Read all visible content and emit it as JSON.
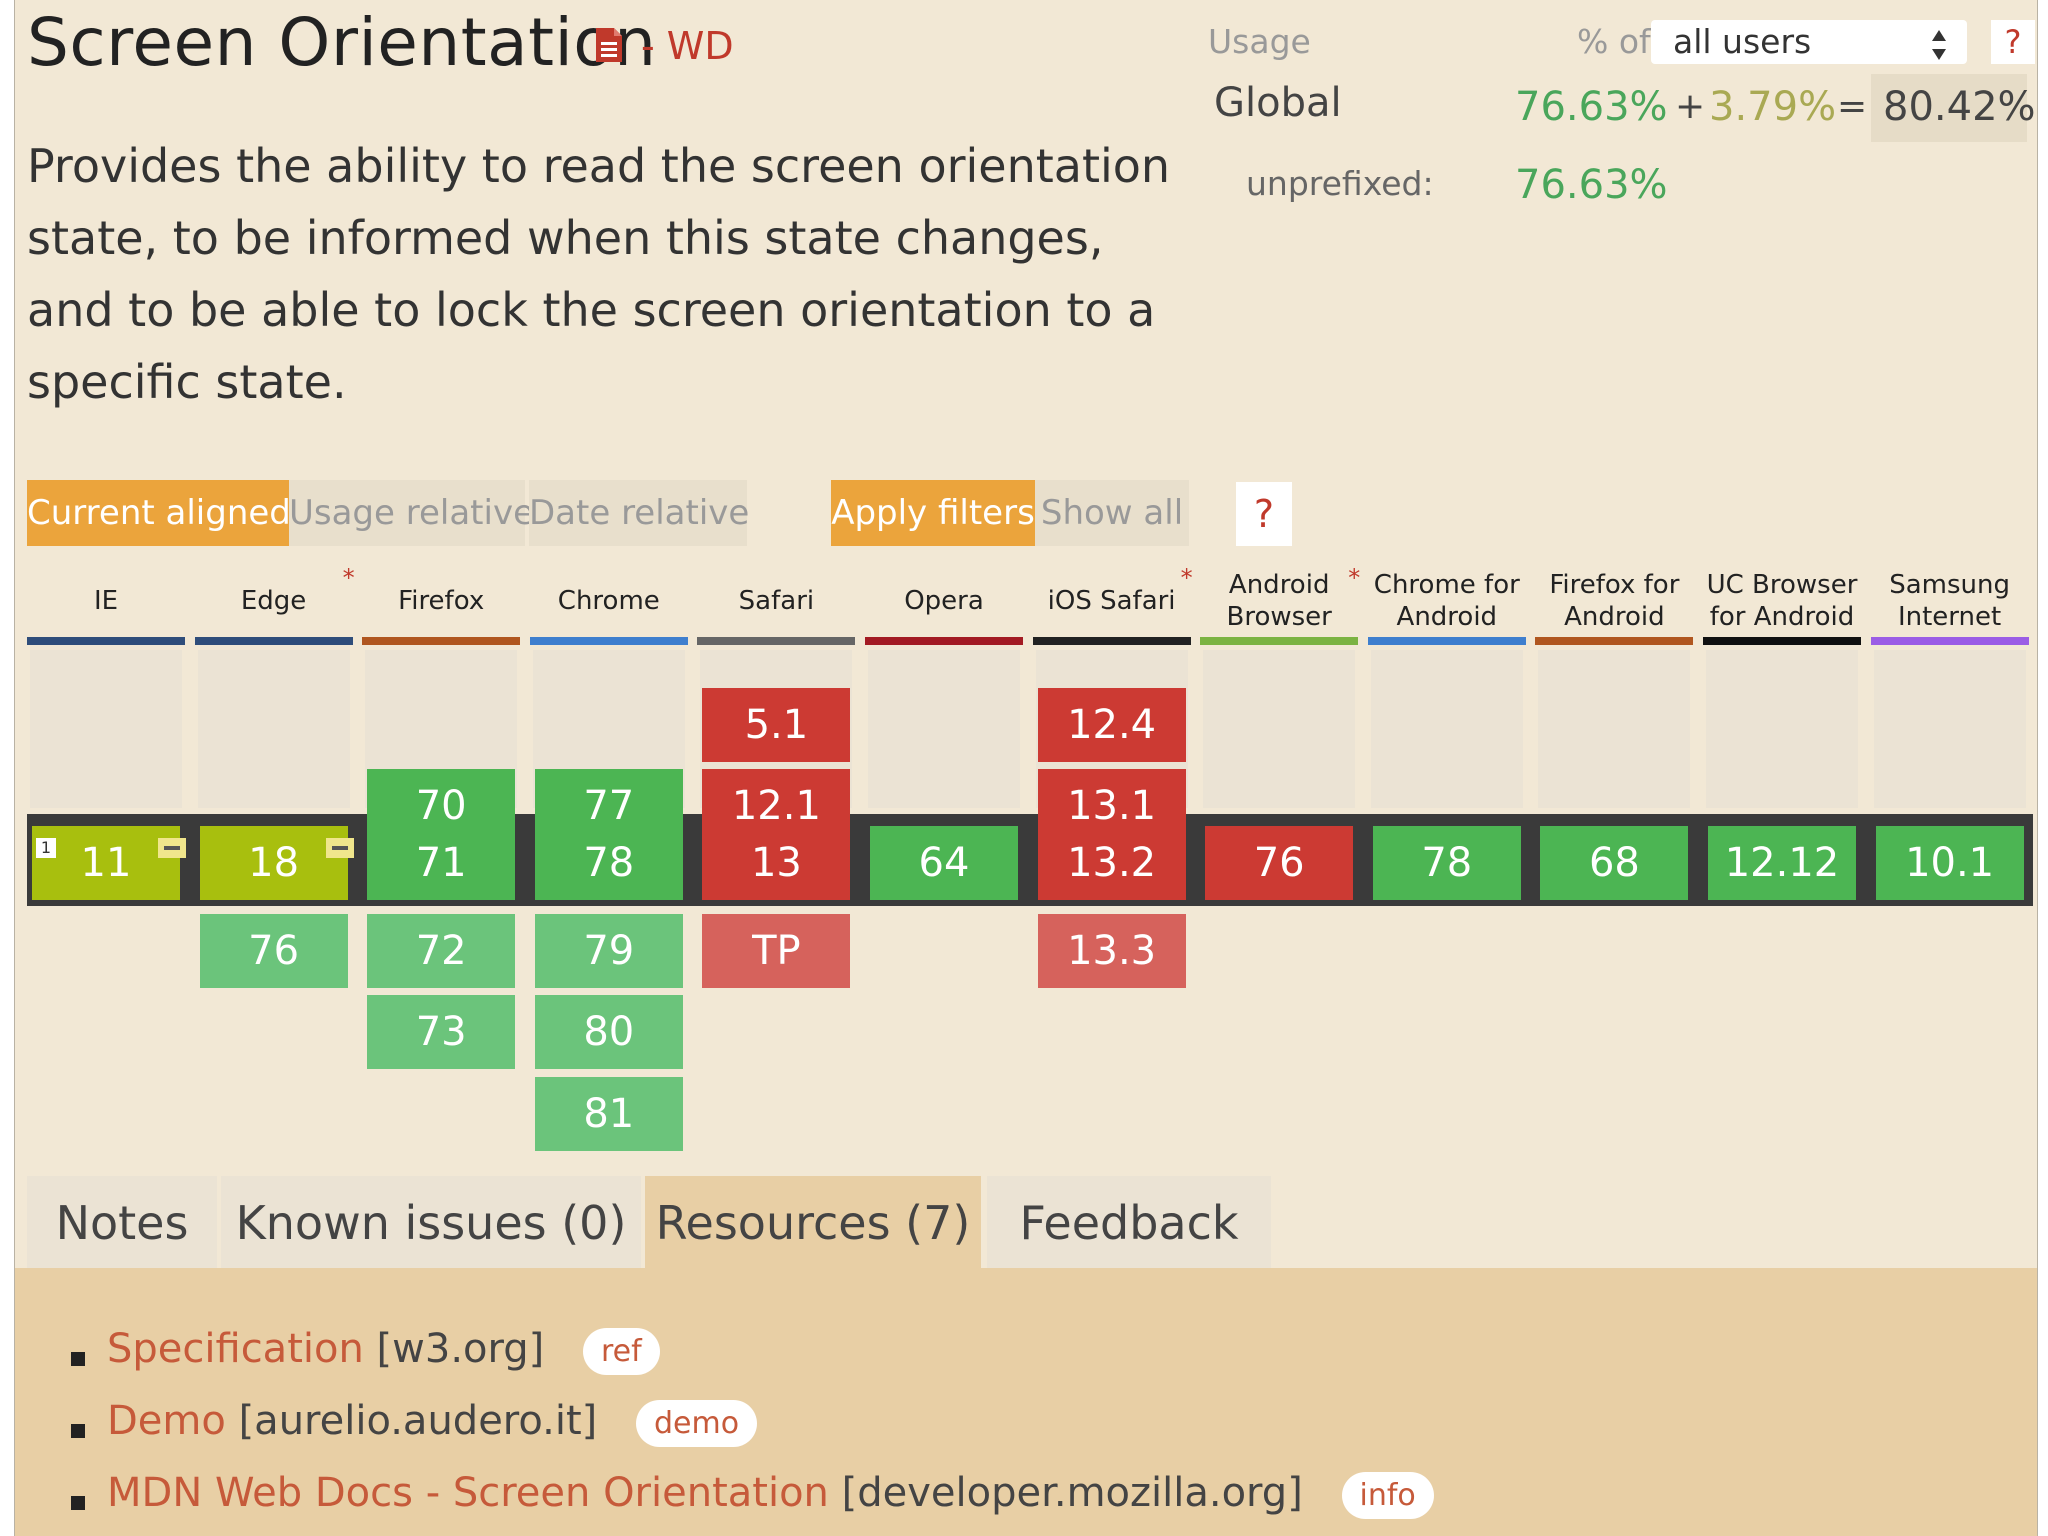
{
  "feature": {
    "title": "Screen Orientation",
    "doc_icon": "document-icon",
    "status": "- WD",
    "description": "Provides the ability to read the screen orientation state, to be informed when this state changes, and to be able to lock the screen orientation to a specific state."
  },
  "usage": {
    "label": "Usage",
    "pct_of": "% of",
    "user_select": "all users",
    "help": "?",
    "global_label": "Global",
    "global_supported": "76.63%",
    "plus": "+",
    "global_partial": "3.79%",
    "equals": "=",
    "global_total": "80.42%",
    "unprefixed_label": "unprefixed:",
    "unprefixed_value": "76.63%"
  },
  "controls": {
    "current_aligned": "Current aligned",
    "usage_relative": "Usage relative",
    "date_relative": "Date relative",
    "apply_filters": "Apply filters",
    "show_all": "Show all",
    "help": "?"
  },
  "colors": {
    "supported": "#4cb553",
    "supported_future": "#6bc47b",
    "unsupported": "#cc3a33",
    "unsupported_future": "#d6625c",
    "partial": "#a8bf0e",
    "accent": "#eba43c"
  },
  "browsers": [
    {
      "name": "IE",
      "star": false,
      "bar": "#2f4d7a",
      "past": [],
      "current": "11",
      "current_support": "partial",
      "note": "1",
      "future": []
    },
    {
      "name": "Edge",
      "star": true,
      "bar": "#2f4d7a",
      "past": [],
      "current": "18",
      "current_support": "partial",
      "future": [
        {
          "v": "76",
          "s": "y"
        }
      ]
    },
    {
      "name": "Firefox",
      "star": false,
      "bar": "#b0561f",
      "past": [
        {
          "v": "70",
          "s": "y"
        }
      ],
      "current": "71",
      "current_support": "supported",
      "future": [
        {
          "v": "72",
          "s": "y"
        },
        {
          "v": "73",
          "s": "y"
        }
      ]
    },
    {
      "name": "Chrome",
      "star": false,
      "bar": "#3f7fce",
      "past": [
        {
          "v": "77",
          "s": "y"
        }
      ],
      "current": "78",
      "current_support": "supported",
      "future": [
        {
          "v": "79",
          "s": "y"
        },
        {
          "v": "80",
          "s": "y"
        },
        {
          "v": "81",
          "s": "y"
        }
      ]
    },
    {
      "name": "Safari",
      "star": false,
      "bar": "#666666",
      "past": [
        {
          "v": "5.1",
          "s": "n"
        },
        {
          "v": "12.1",
          "s": "n"
        }
      ],
      "current": "13",
      "current_support": "unsupported",
      "future": [
        {
          "v": "TP",
          "s": "n"
        }
      ]
    },
    {
      "name": "Opera",
      "star": false,
      "bar": "#a31b23",
      "past": [],
      "current": "64",
      "current_support": "supported",
      "future": []
    },
    {
      "name": "iOS Safari",
      "star": true,
      "bar": "#222222",
      "past": [
        {
          "v": "12.4",
          "s": "n"
        },
        {
          "v": "13.1",
          "s": "n"
        }
      ],
      "current": "13.2",
      "current_support": "unsupported",
      "future": [
        {
          "v": "13.3",
          "s": "n"
        }
      ]
    },
    {
      "name": "Android Browser",
      "star": true,
      "bar": "#7cb342",
      "past": [],
      "current": "76",
      "current_support": "unsupported",
      "future": []
    },
    {
      "name": "Chrome for Android",
      "star": false,
      "bar": "#3f7fce",
      "past": [],
      "current": "78",
      "current_support": "supported",
      "future": []
    },
    {
      "name": "Firefox for Android",
      "star": false,
      "bar": "#b0561f",
      "past": [],
      "current": "68",
      "current_support": "supported",
      "future": []
    },
    {
      "name": "UC Browser for Android",
      "star": false,
      "bar": "#111111",
      "past": [],
      "current": "12.12",
      "current_support": "supported",
      "future": []
    },
    {
      "name": "Samsung Internet",
      "star": false,
      "bar": "#9b5de5",
      "past": [],
      "current": "10.1",
      "current_support": "supported",
      "future": []
    }
  ],
  "tabs": {
    "notes": "Notes",
    "known_issues": "Known issues (0)",
    "resources": "Resources (7)",
    "feedback": "Feedback"
  },
  "resources": [
    {
      "link": "Specification",
      "domain": "[w3.org]",
      "tag": "ref"
    },
    {
      "link": "Demo",
      "domain": "[aurelio.audero.it]",
      "tag": "demo"
    },
    {
      "link": "MDN Web Docs - Screen Orientation",
      "domain": "[developer.mozilla.org]",
      "tag": "info"
    }
  ]
}
